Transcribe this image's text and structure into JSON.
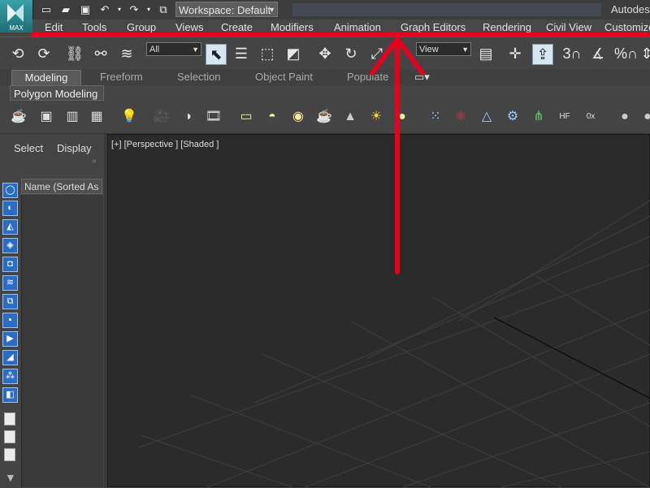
{
  "titlebar": {
    "logo_text": "MAX",
    "workspace": "Workspace: Default",
    "brand": "Autodes"
  },
  "menu": [
    "Edit",
    "Tools",
    "Group",
    "Views",
    "Create",
    "Modifiers",
    "Animation",
    "Graph Editors",
    "Rendering",
    "Civil View",
    "Customize"
  ],
  "toolbar": {
    "selection_filter": "All",
    "reference_coord": "View"
  },
  "ribbon": {
    "tabs": [
      "Modeling",
      "Freeform",
      "Selection",
      "Object Paint",
      "Populate"
    ],
    "panel": "Polygon Modeling"
  },
  "scene_explorer": {
    "tabs": [
      "Select",
      "Display"
    ],
    "column_header": "Name (Sorted As"
  },
  "viewport": {
    "label": "[+] [Perspective ] [Shaded ]"
  },
  "colors": {
    "annotation_red": "#e6001e",
    "viewport_bg": "#2b2b2b",
    "accent_blue": "#2c6cc0"
  }
}
